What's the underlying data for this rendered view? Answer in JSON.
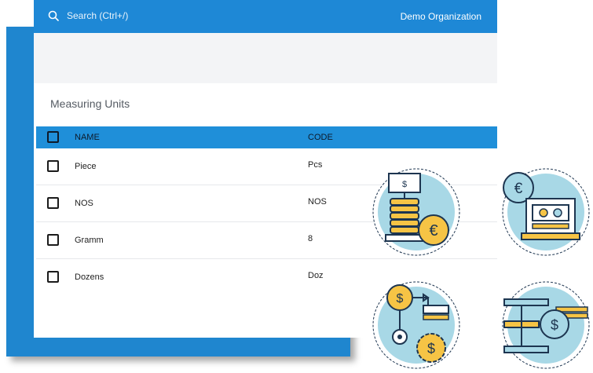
{
  "header": {
    "search_placeholder": "Search (Ctrl+/)",
    "organization": "Demo Organization"
  },
  "page": {
    "title": "Measuring Units"
  },
  "table": {
    "columns": [
      "NAME",
      "CODE"
    ],
    "rows": [
      {
        "name": "Piece",
        "code": "Pcs"
      },
      {
        "name": "NOS",
        "code": "NOS"
      },
      {
        "name": "Gramm",
        "code": "8"
      },
      {
        "name": "Dozens",
        "code": "Doz"
      }
    ]
  },
  "icons": {
    "symbols": [
      "$",
      "€",
      "$",
      "$",
      "$",
      "$"
    ]
  },
  "colors": {
    "topbar": "#1e88d6",
    "table_header": "#1f8fd9",
    "back_frame": "#1f86cf",
    "icon_circle": "#a8d8e6",
    "icon_yellow": "#f6c445",
    "icon_stroke": "#1d3550"
  }
}
